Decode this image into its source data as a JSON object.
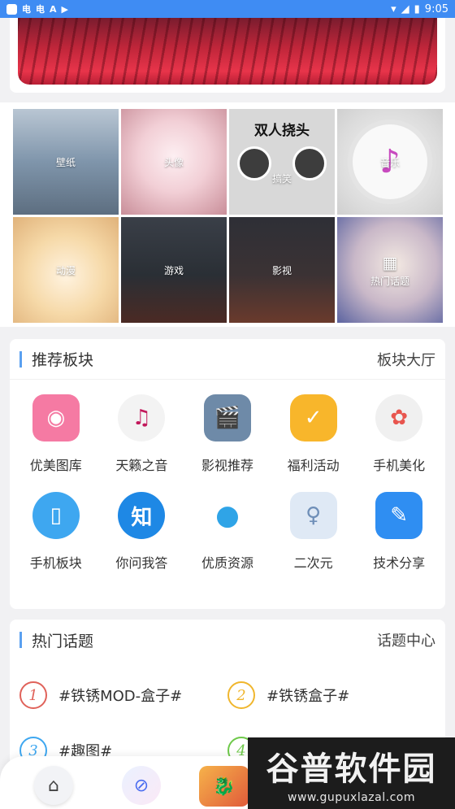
{
  "status_bar": {
    "time": "9:05",
    "left_glyphs": [
      "电",
      "电",
      "A",
      "▶"
    ]
  },
  "banner": {
    "alt": ""
  },
  "categories": [
    {
      "label": "壁纸",
      "icon": ""
    },
    {
      "label": "头像",
      "icon": ""
    },
    {
      "label": "搞笑",
      "icon": "",
      "caption": "双人挠头"
    },
    {
      "label": "音乐",
      "icon": "♪"
    },
    {
      "label": "动漫",
      "icon": ""
    },
    {
      "label": "游戏",
      "icon": ""
    },
    {
      "label": "影视",
      "icon": ""
    },
    {
      "label": "热门话题",
      "icon": "▦"
    }
  ],
  "recommend": {
    "title": "推荐板块",
    "link": "板块大厅",
    "items": [
      {
        "label": "优美图库",
        "icon": "camera-icon",
        "glyph": "◉",
        "color": "#f57aa3"
      },
      {
        "label": "天籁之音",
        "icon": "music-note-icon",
        "glyph": "♫",
        "color": "#f3f3f3"
      },
      {
        "label": "影视推荐",
        "icon": "clapperboard-icon",
        "glyph": "🎬",
        "color": "#6e8aa8"
      },
      {
        "label": "福利活动",
        "icon": "gift-icon",
        "glyph": "✓",
        "color": "#f8b62b"
      },
      {
        "label": "手机美化",
        "icon": "flower-icon",
        "glyph": "✿",
        "color": "#f0f0f0"
      },
      {
        "label": "手机板块",
        "icon": "phone-icon",
        "glyph": "▯",
        "color": "#3ea7f0"
      },
      {
        "label": "你问我答",
        "icon": "zhihu-icon",
        "glyph": "知",
        "color": "#1e88e5"
      },
      {
        "label": "优质资源",
        "icon": "basketball-icon",
        "glyph": "●",
        "color": "#ffffff"
      },
      {
        "label": "二次元",
        "icon": "anime-icon",
        "glyph": "♀",
        "color": "#dfe9f5"
      },
      {
        "label": "技术分享",
        "icon": "wrench-icon",
        "glyph": "✎",
        "color": "#2f8ef2"
      }
    ]
  },
  "hot_topics": {
    "title": "热门话题",
    "link": "话题中心",
    "items": [
      {
        "num": "1",
        "text": "#铁锈MOD-盒子#",
        "color": "#e0625a"
      },
      {
        "num": "2",
        "text": "#铁锈盒子#",
        "color": "#f0b62d"
      },
      {
        "num": "3",
        "text": "#趣图#",
        "color": "#3ea7f0"
      },
      {
        "num": "4",
        "text": "",
        "color": "#6ec94a"
      }
    ]
  },
  "bottom_nav": {
    "home": "⌂",
    "compass": "⊘",
    "dragon": "🐉"
  },
  "watermark": {
    "brand": "谷普软件园",
    "url": "www.gupuxlazal.com"
  }
}
